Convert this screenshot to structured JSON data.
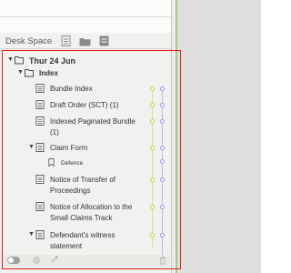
{
  "toolbar": {
    "label": "Desk Space",
    "icons": [
      "document-icon",
      "folder-icon",
      "note-icon"
    ]
  },
  "tree": {
    "date": "Thur 24 Jun",
    "index": "Index",
    "items": {
      "bundle_index": "Bundle Index",
      "draft_order": "Draft Order (SCT) (1)",
      "indexed_bundle": "Indexed Paginated Bundle (1)",
      "claim_form": "Claim Form",
      "defence": "Defence",
      "notice_transfer": "Notice of Transfer of Proceedings",
      "notice_allocation": "Notice of Allocation to the Small Claims Track",
      "defendant_witness": "Defendant's witness statement"
    }
  },
  "colors": {
    "highlight_frame": "#e2231a",
    "green_track": "#a8d84a",
    "purple_track": "#a58cf0",
    "panel_green_line": "#a3c88d"
  }
}
